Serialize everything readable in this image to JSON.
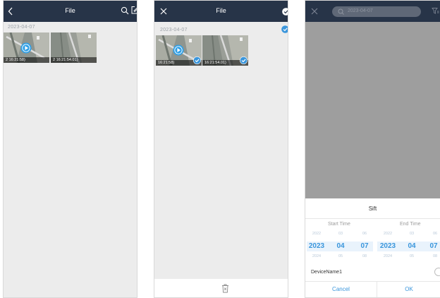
{
  "screen1": {
    "title": "File",
    "date": "2023-04-07",
    "thumbs": [
      {
        "time": "2 16:21:58)"
      },
      {
        "time": "2 16:21:54.01)"
      }
    ]
  },
  "screen2": {
    "title": "File",
    "date": "2023-04-07",
    "thumbs": [
      {
        "time": "16:21:58)"
      },
      {
        "time": "16:21:54.01)"
      }
    ]
  },
  "screen3": {
    "search_text": "2023-04-07",
    "sheet_title": "Sift",
    "start_label": "Start Time",
    "end_label": "End Time",
    "start": {
      "prev": [
        "2022",
        "03",
        "06"
      ],
      "cur": [
        "2023",
        "04",
        "07"
      ],
      "next": [
        "2024",
        "05",
        "08"
      ]
    },
    "end": {
      "prev": [
        "2022",
        "03",
        "06"
      ],
      "cur": [
        "2023",
        "04",
        "07"
      ],
      "next": [
        "2024",
        "05",
        "08"
      ]
    },
    "device_name": "DeviceName1",
    "cancel_label": "Cancel",
    "ok_label": "OK"
  },
  "colors": {
    "topbar": "#273448",
    "accent": "#3a96dc",
    "play": "#2f9fe6",
    "background": "#ececec",
    "dim_overlay": "#9e9e9e"
  },
  "icons": [
    "back-icon",
    "search-icon",
    "edit-icon",
    "play-icon",
    "close-icon",
    "select-all-icon",
    "check-icon",
    "delete-icon",
    "filter-icon"
  ]
}
